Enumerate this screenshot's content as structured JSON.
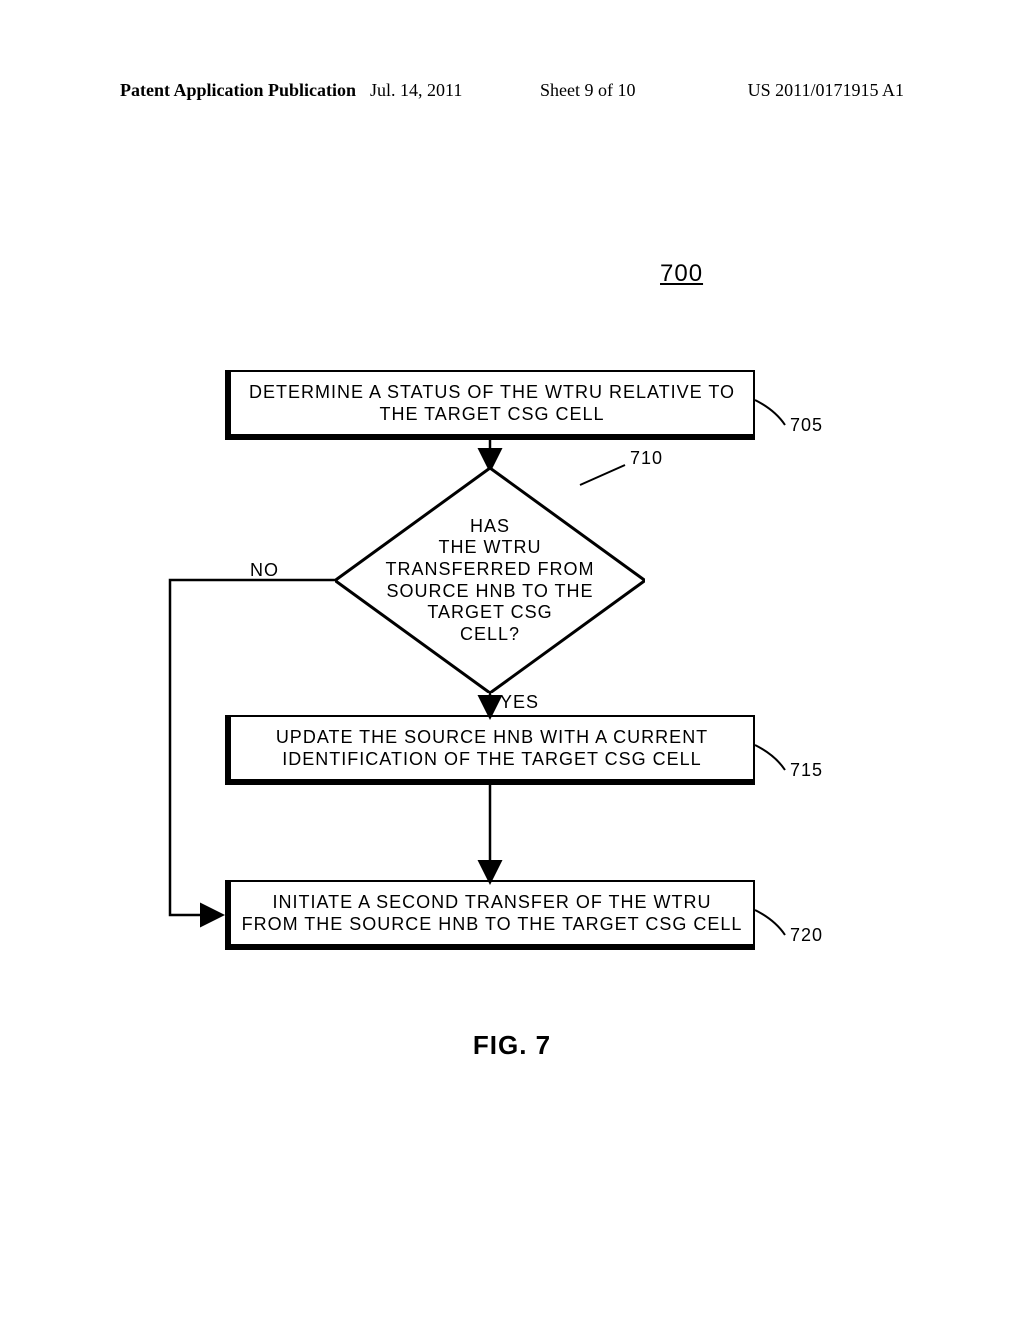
{
  "header": {
    "left": "Patent Application Publication",
    "date": "Jul. 14, 2011",
    "sheet": "Sheet 9 of 10",
    "pubno": "US 2011/0171915 A1"
  },
  "figure_ref": "700",
  "flowchart": {
    "box705": "DETERMINE A STATUS OF THE WTRU RELATIVE TO THE TARGET CSG CELL",
    "decision710": "HAS\nTHE WTRU\nTRANSFERRED FROM\nSOURCE HNB TO THE\nTARGET CSG\nCELL?",
    "box715": "UPDATE THE SOURCE HNB WITH A CURRENT IDENTIFICATION OF THE TARGET CSG CELL",
    "box720": "INITIATE A SECOND TRANSFER OF THE WTRU FROM THE SOURCE HNB TO THE TARGET CSG CELL",
    "yes": "YES",
    "no": "NO"
  },
  "refs": {
    "r705": "705",
    "r710": "710",
    "r715": "715",
    "r720": "720"
  },
  "caption": "FIG. 7"
}
